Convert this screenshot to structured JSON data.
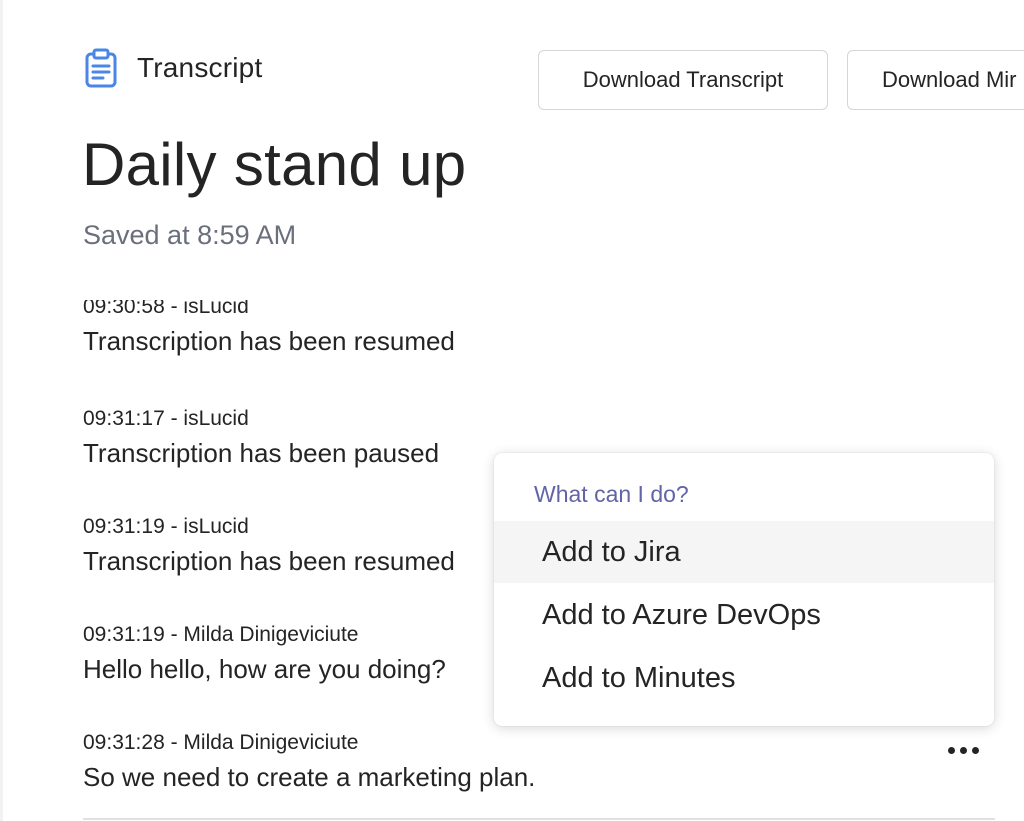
{
  "header": {
    "section_label": "Transcript",
    "section_icon": "clipboard-icon",
    "download_transcript_label": "Download Transcript",
    "download_minutes_label": "Download Mir"
  },
  "meeting": {
    "title": "Daily stand up",
    "saved_status": "Saved at 8:59 AM"
  },
  "transcript": {
    "entries": [
      {
        "meta": "09:30:58 - isLucid",
        "text": "Transcription has been resumed"
      },
      {
        "meta": "09:31:17 - isLucid",
        "text": "Transcription has been paused"
      },
      {
        "meta": "09:31:19 - isLucid",
        "text": "Transcription has been resumed"
      },
      {
        "meta": "09:31:19 - Milda Dinigeviciute",
        "text": "Hello hello, how are you doing?"
      },
      {
        "meta": "09:31:28 - Milda Dinigeviciute",
        "text": "So we need to create a marketing plan."
      }
    ],
    "more_icon": "more-horizontal-icon"
  },
  "context_menu": {
    "heading": "What can I do?",
    "items": [
      {
        "label": "Add to Jira",
        "hovered": true
      },
      {
        "label": "Add to Azure DevOps",
        "hovered": false
      },
      {
        "label": "Add to Minutes",
        "hovered": false
      }
    ]
  },
  "colors": {
    "accent": "#6264a7",
    "icon_blue": "#4a86e8",
    "muted_text": "#6b6f7c",
    "hover_bg": "#f5f5f5"
  }
}
